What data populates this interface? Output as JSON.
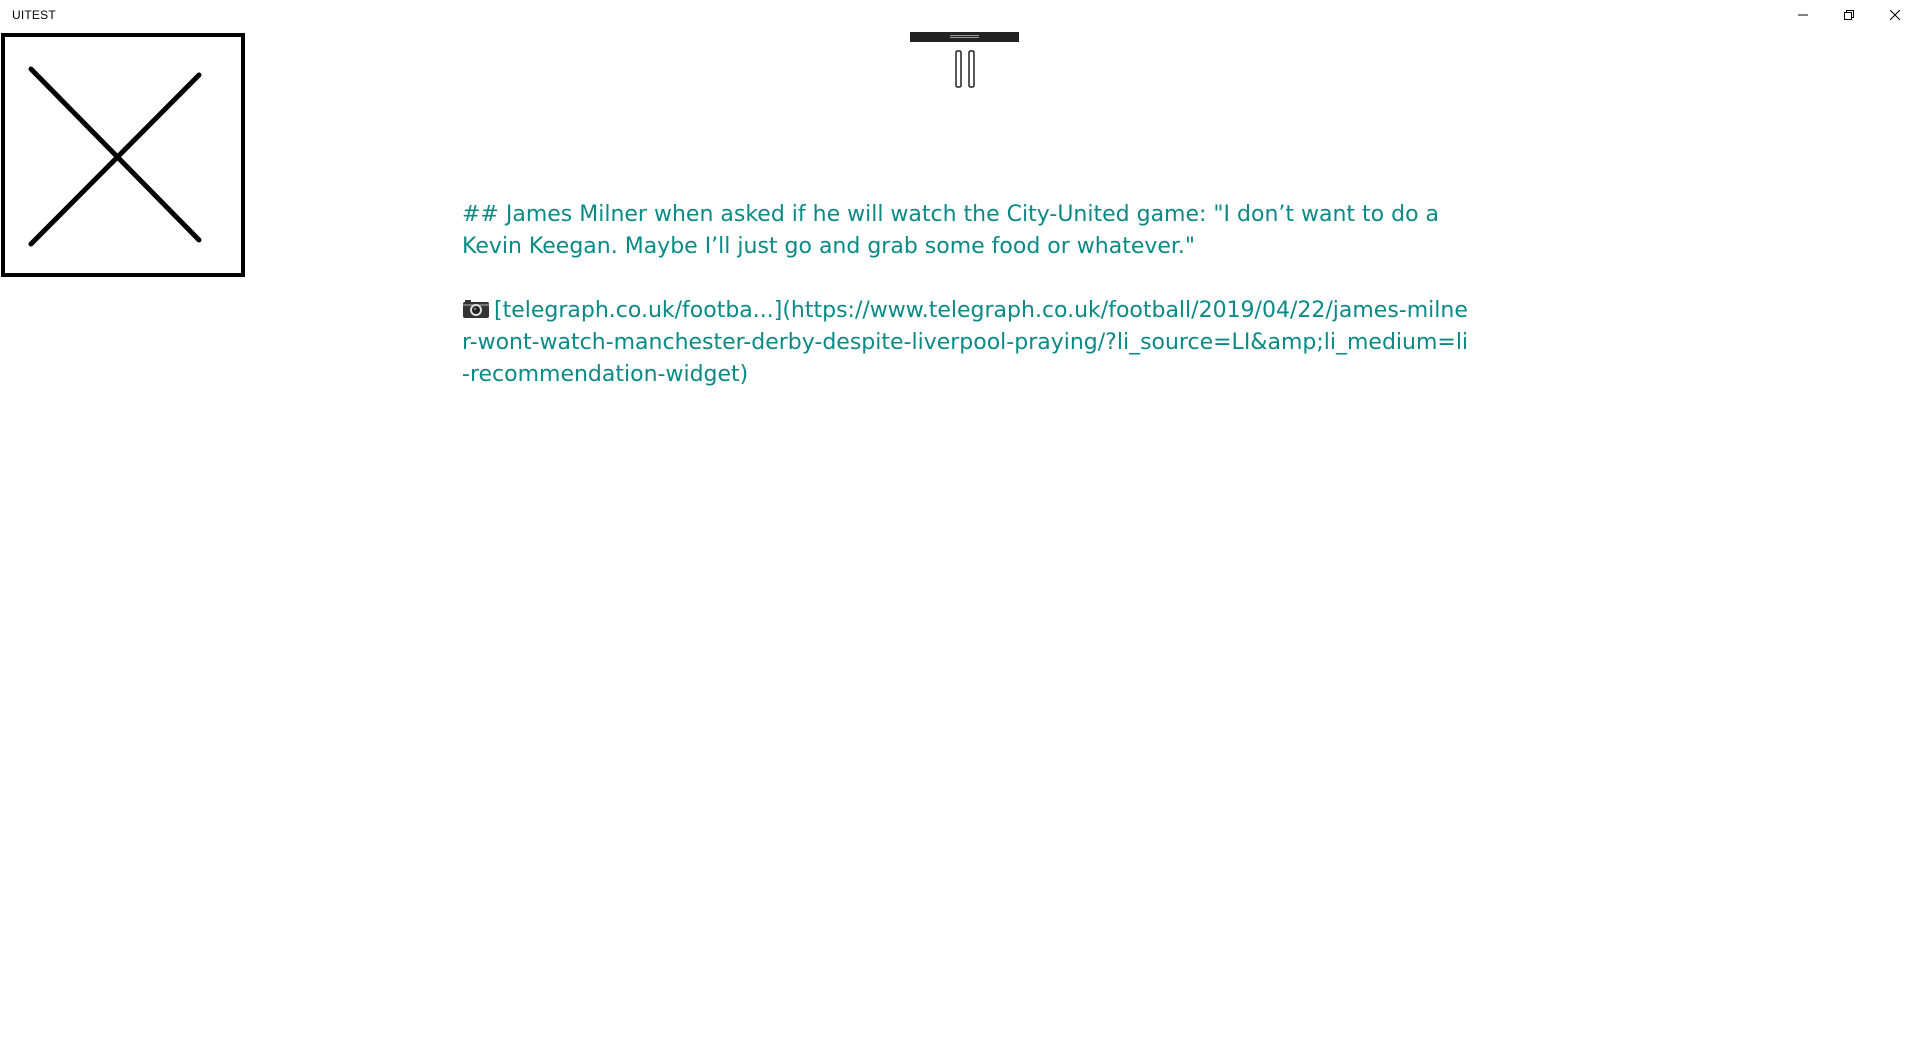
{
  "window": {
    "title": "UITEST",
    "controls": {
      "minimize_icon": "minimize-icon",
      "restore_icon": "restore-icon",
      "close_icon": "close-icon"
    }
  },
  "image_placeholder": {
    "icon": "broken-image-x-icon"
  },
  "player": {
    "handle_icon": "drag-handle-icon",
    "state_icon": "pause-icon"
  },
  "post": {
    "headline": "## James Milner when asked if he will watch the City-United game: \"I don’t want to do a Kevin Keegan. Maybe I’ll just go and grab some food or whatever.\"",
    "camera_icon": "camera-icon",
    "link_text": "[telegraph.co.uk/footba...](https://www.telegraph.co.uk/football/2019/04/22/james-milner-wont-watch-manchester-derby-despite-liverpool-praying/?li_source=LI&amp;li_medium=li-recommendation-widget)",
    "text_color": "#0a8a86"
  }
}
